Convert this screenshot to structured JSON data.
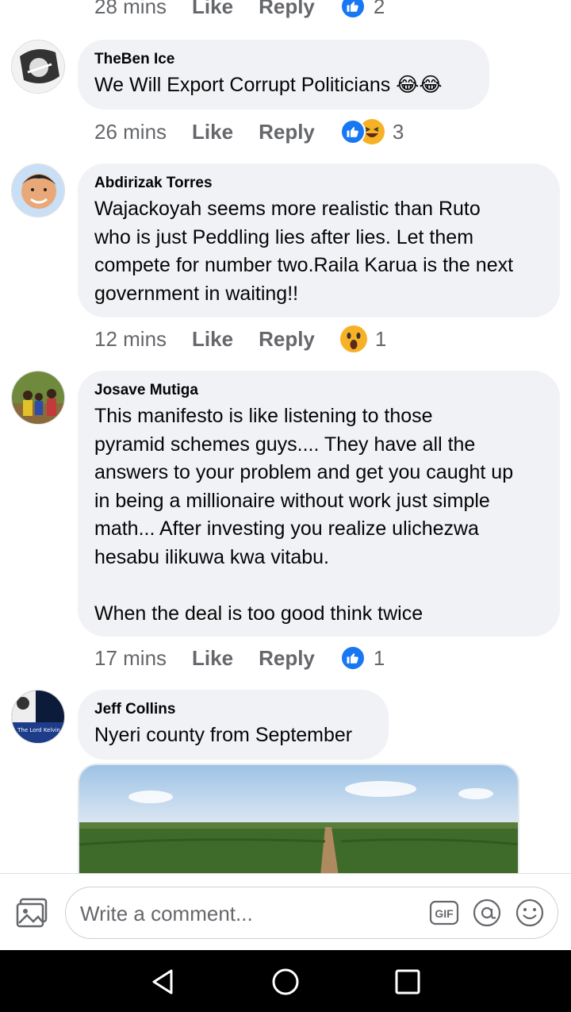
{
  "comments": [
    {
      "meta": {
        "time": "28 mins",
        "like": "Like",
        "reply": "Reply",
        "count": "2"
      }
    },
    {
      "name": "TheBen Ice",
      "text": "We Will Export Corrupt Politicians 😂😂",
      "meta": {
        "time": "26 mins",
        "like": "Like",
        "reply": "Reply",
        "count": "3"
      }
    },
    {
      "name": "Abdirizak Torres",
      "text": "Wajackoyah seems more realistic than Ruto\nwho is just Peddling lies after lies. Let them\ncompete for number two.Raila Karua is the next\ngovernment in waiting!!",
      "meta": {
        "time": "12 mins",
        "like": "Like",
        "reply": "Reply",
        "count": "1"
      }
    },
    {
      "name": "Josave Mutiga",
      "text": "This manifesto is like listening to those\npyramid schemes guys.... They have all the\nanswers to your problem and get you caught up\nin being a millionaire without work just simple\nmath... After investing you realize ulichezwa\nhesabu ilikuwa kwa vitabu.\n\nWhen the deal is too good think twice",
      "meta": {
        "time": "17 mins",
        "like": "Like",
        "reply": "Reply",
        "count": "1"
      }
    },
    {
      "name": "Jeff Collins",
      "text": "Nyeri county from September",
      "avatar_text": "The Lord Kelvin"
    }
  ],
  "composer": {
    "placeholder": "Write a comment...",
    "gif_label": "GIF"
  },
  "colors": {
    "accent": "#1877f2",
    "bubble": "#f0f2f5",
    "meta_text": "#65676b",
    "reaction_yellow": "#f7b125"
  },
  "icons": [
    "like-reaction-icon",
    "haha-reaction-icon",
    "wow-reaction-icon",
    "photo-icon",
    "gif-icon",
    "mention-icon",
    "emoji-icon",
    "back-icon",
    "home-icon",
    "recent-apps-icon"
  ]
}
